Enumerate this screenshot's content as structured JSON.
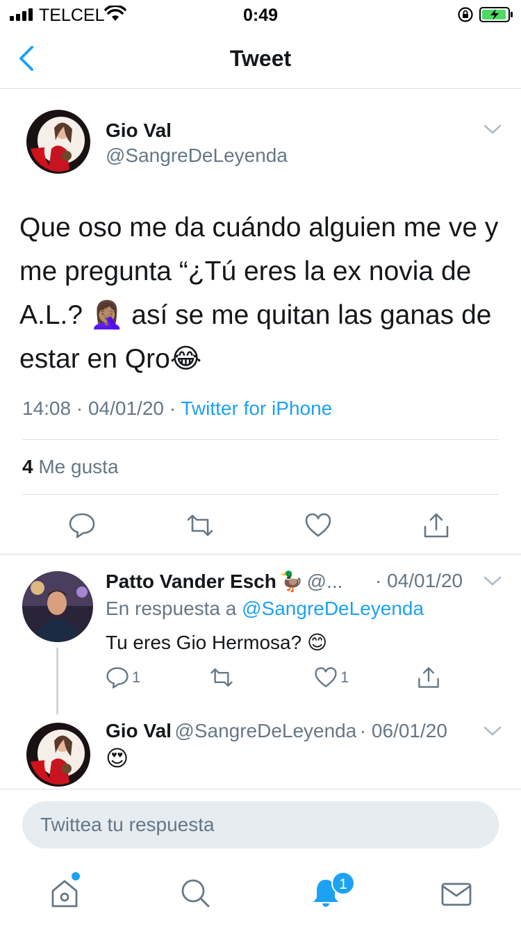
{
  "status_bar": {
    "carrier": "TELCEL",
    "time": "0:49"
  },
  "nav": {
    "title": "Tweet"
  },
  "main_tweet": {
    "name": "Gio Val",
    "handle": "@SangreDeLeyenda",
    "text": "Que oso me da cuándo alguien me ve y me pregunta “¿Tú eres la ex novia de A.L.? 🤦🏽‍♀️ así se me quitan las ganas de estar en Qro😂",
    "time": "14:08",
    "date": "04/01/20",
    "separator": "·",
    "source": "Twitter for iPhone",
    "likes_count": "4",
    "likes_label": "Me gusta"
  },
  "replies": [
    {
      "name": "Patto Vander Esch",
      "name_emoji": "🦆",
      "handle": "@...",
      "date": "· 04/01/20",
      "reply_to_label": "En respuesta a",
      "reply_to_handle": "@SangreDeLeyenda",
      "text": "Tu eres Gio Hermosa? 😊",
      "reply_count": "1",
      "like_count": "1"
    },
    {
      "name": "Gio Val",
      "handle": "@SangreDeLeyenda",
      "date": "· 06/01/20",
      "text": "😍"
    }
  ],
  "composer": {
    "placeholder": "Twittea tu respuesta"
  },
  "tab_bar": {
    "notifications_badge": "1"
  },
  "colors": {
    "accent": "#1da1f2",
    "secondary_text": "#657786",
    "divider": "#d9dee2"
  }
}
